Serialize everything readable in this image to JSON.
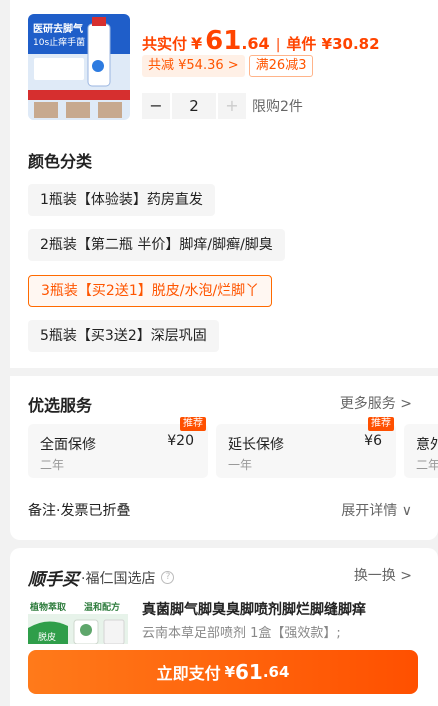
{
  "product": {
    "price_label": "共实付",
    "currency": "¥",
    "price_int": "61",
    "price_dec": ".64",
    "separator": "|",
    "unit_price": "单件 ¥30.82",
    "promo_total": "共减 ¥54.36 >",
    "promo_coupon": "满26减3",
    "quantity": "2",
    "limit_text": "限购2件",
    "thumb_text_line1": "医研去脚气",
    "thumb_text_line2": "10s止痒手菌"
  },
  "color_section": {
    "title": "颜色分类",
    "options": [
      "1瓶装【体验装】药房直发",
      "2瓶装【第二瓶 半价】脚痒/脚癣/脚臭",
      "3瓶装【买2送1】脱皮/水泡/烂脚丫",
      "5瓶装【买3送2】深层巩固"
    ],
    "selected_index": 2
  },
  "service_section": {
    "title": "优选服务",
    "more": "更多服务 >",
    "cards": [
      {
        "name": "全面保修",
        "sub": "二年",
        "price": "¥20",
        "badge": "推荐"
      },
      {
        "name": "延长保修",
        "sub": "一年",
        "price": "¥6",
        "badge": "推荐"
      },
      {
        "name": "意外",
        "sub": "二年"
      }
    ]
  },
  "note": {
    "left": "备注·发票已折叠",
    "right": "展开详情 ∨"
  },
  "recommend": {
    "brand": "顺手买",
    "store": "·福仁国选店",
    "help": "?",
    "swap": "换一换 >",
    "thumb_tag1": "植物萃取",
    "thumb_tag2": "温和配方",
    "thumb_tag3": "脱皮",
    "title": "真菌脚气脚臭臭脚喷剂脚烂脚缝脚痒",
    "sub": "云南本草足部喷剂 1盒【强效款】;"
  },
  "pay_button": {
    "label": "立即支付",
    "currency": "¥",
    "int": "61",
    "dec": ".64"
  },
  "colors": {
    "accent": "#ff5000",
    "accent_light": "#fff0e6"
  }
}
